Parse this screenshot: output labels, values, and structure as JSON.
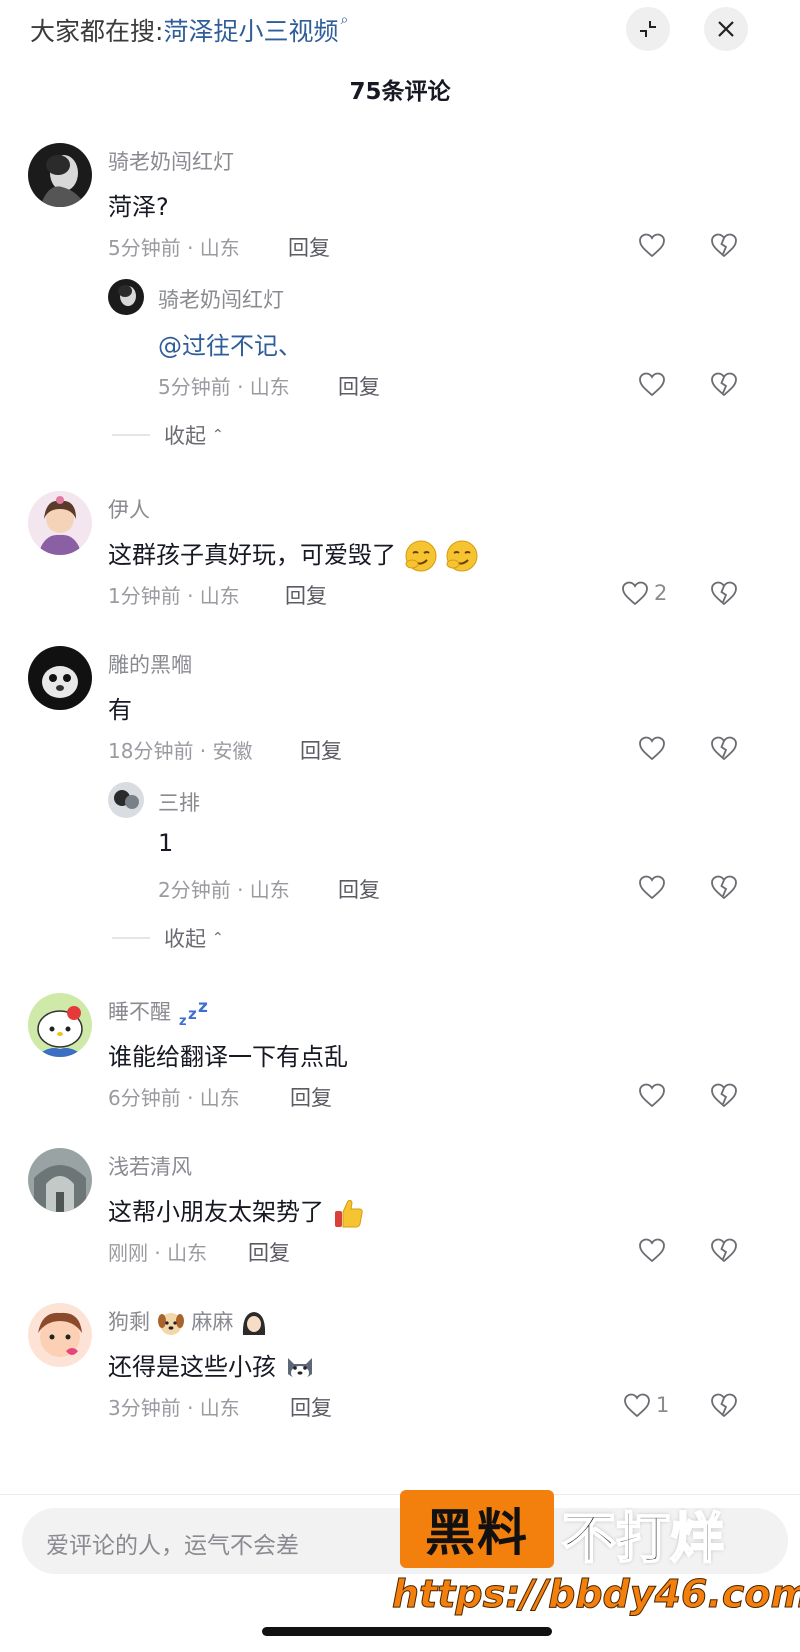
{
  "header": {
    "search_prefix": "大家都在搜:",
    "search_term": "菏泽捉小三视频",
    "comment_count": "75条评论"
  },
  "comments": [
    {
      "username": "骑老奶闯红灯",
      "text": "菏泽?",
      "meta": "5分钟前 · 山东",
      "reply_label": "回复",
      "replies": [
        {
          "username": "骑老奶闯红灯",
          "text": "@过往不记、",
          "meta": "5分钟前 · 山东",
          "reply_label": "回复"
        }
      ],
      "collapse_label": "收起"
    },
    {
      "username": "伊人",
      "text": "这群孩子真好玩，可爱毁了",
      "meta": "1分钟前 · 山东",
      "reply_label": "回复",
      "likes": "2"
    },
    {
      "username": "雕的黑嗰",
      "text": "有",
      "meta": "18分钟前 · 安徽",
      "reply_label": "回复",
      "replies": [
        {
          "username": "三排",
          "text": "1",
          "meta": "2分钟前 · 山东",
          "reply_label": "回复"
        }
      ],
      "collapse_label": "收起"
    },
    {
      "username": "睡不醒",
      "text": "谁能给翻译一下有点乱",
      "meta": "6分钟前 · 山东",
      "reply_label": "回复"
    },
    {
      "username": "浅若清风",
      "text": "这帮小朋友太架势了",
      "meta": "刚刚 · 山东",
      "reply_label": "回复"
    },
    {
      "username_part1": "狗剩",
      "username_part2": "麻麻",
      "text": "还得是这些小孩",
      "meta": "3分钟前 · 山东",
      "reply_label": "回复",
      "likes": "1"
    }
  ],
  "input": {
    "placeholder": "爱评论的人，运气不会差"
  },
  "watermark": {
    "box_text": "黑料",
    "text": "不打烊",
    "url": "https://bbdy46.com"
  },
  "colors": {
    "link": "#2f5d9a",
    "watermark_orange": "#f37f0d"
  }
}
